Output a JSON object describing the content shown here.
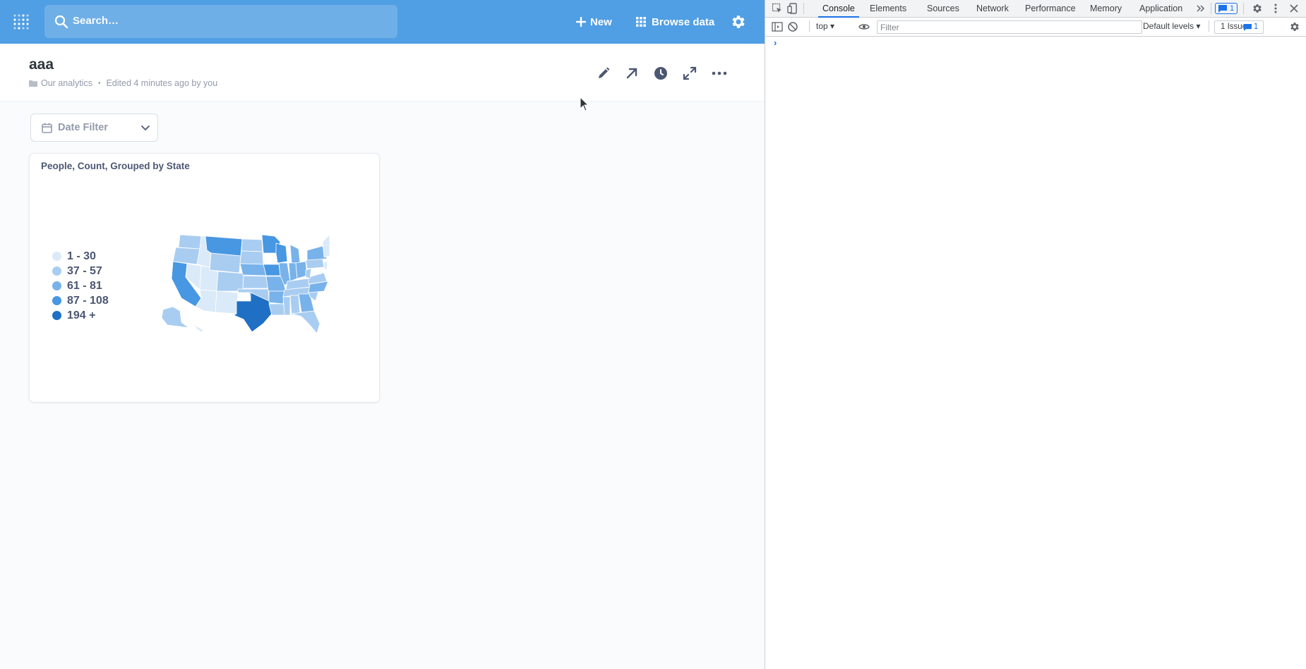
{
  "navbar": {
    "search_placeholder": "Search…",
    "new_label": "New",
    "browse_label": "Browse data",
    "brand_color": "#509ee3"
  },
  "dashboard": {
    "title": "aaa",
    "collection": "Our analytics",
    "edited": "Edited 4 minutes ago by you"
  },
  "filter": {
    "label": "Date Filter"
  },
  "card": {
    "title": "People, Count, Grouped by State",
    "legend": [
      {
        "label": "1 - 30",
        "color": "#dbeaf8"
      },
      {
        "label": "37 - 57",
        "color": "#a9cdf1"
      },
      {
        "label": "61 - 81",
        "color": "#78b2ea"
      },
      {
        "label": "87 - 108",
        "color": "#4797e2"
      },
      {
        "label": "194 +",
        "color": "#1f70c4"
      }
    ]
  },
  "devtools": {
    "tabs": [
      "Console",
      "Elements",
      "Sources",
      "Network",
      "Performance",
      "Memory",
      "Application"
    ],
    "active_tab": "Console",
    "message_badge": "1",
    "context": "top",
    "filter_placeholder": "Filter",
    "levels": "Default levels",
    "issues_label": "1 Issue:",
    "issues_count": "1",
    "prompt": "›"
  }
}
